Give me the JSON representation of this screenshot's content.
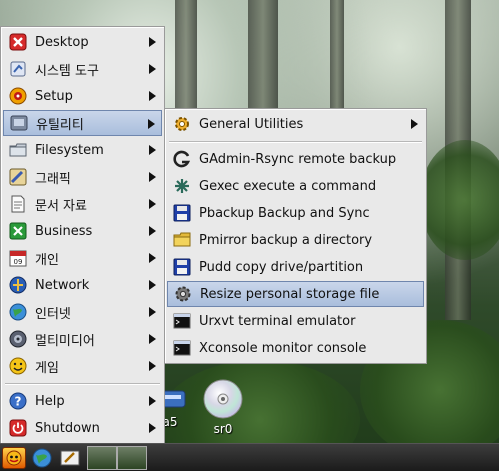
{
  "main_menu": {
    "items": [
      {
        "label": "Desktop"
      },
      {
        "label": "시스템 도구"
      },
      {
        "label": "Setup"
      },
      {
        "label": "유틸리티"
      },
      {
        "label": "Filesystem"
      },
      {
        "label": "그래픽"
      },
      {
        "label": "문서 자료"
      },
      {
        "label": "Business"
      },
      {
        "label": "개인"
      },
      {
        "label": "Network"
      },
      {
        "label": "인터넷"
      },
      {
        "label": "멀티미디어"
      },
      {
        "label": "게임"
      },
      {
        "label": "Help"
      },
      {
        "label": "Shutdown"
      }
    ]
  },
  "sub_menu": {
    "items": [
      {
        "label": "General Utilities"
      },
      {
        "label": "GAdmin-Rsync remote backup"
      },
      {
        "label": "Gexec execute a command"
      },
      {
        "label": "Pbackup Backup and Sync"
      },
      {
        "label": "Pmirror backup a directory"
      },
      {
        "label": "Pudd copy drive/partition"
      },
      {
        "label": "Resize personal storage file"
      },
      {
        "label": "Urxvt terminal emulator"
      },
      {
        "label": "Xconsole monitor console"
      }
    ]
  },
  "desktop": {
    "icons": [
      {
        "label": "a5"
      },
      {
        "label": "sr0"
      }
    ]
  },
  "colors": {
    "menu_bg": "#e9e9e9",
    "selection": "#a9bedc",
    "taskbar": "#1b1b1b"
  }
}
